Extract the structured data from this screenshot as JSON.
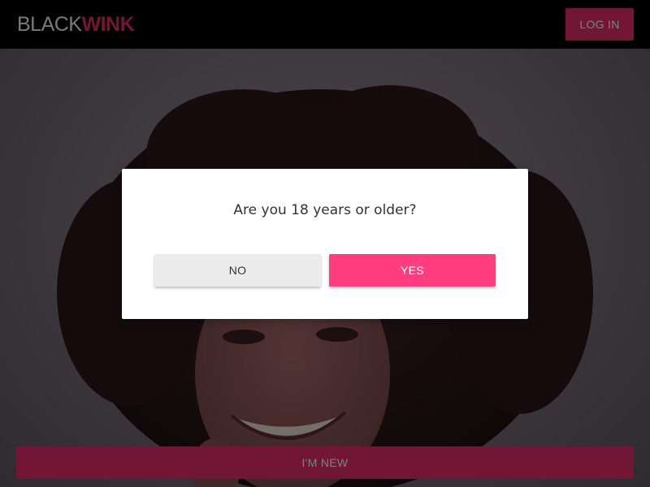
{
  "header": {
    "logo_black": "BLACK",
    "logo_wink": "WINK",
    "login_label": "LOG IN"
  },
  "hero": {
    "new_button_label": "I'M NEW"
  },
  "age_gate": {
    "question": "Are you 18 years or older?",
    "no_label": "NO",
    "yes_label": "YES"
  },
  "colors": {
    "brand_pink": "#e22c6b",
    "yes_pink": "#ff3d7f",
    "header_bg": "#000000",
    "no_bg": "#ececec"
  }
}
